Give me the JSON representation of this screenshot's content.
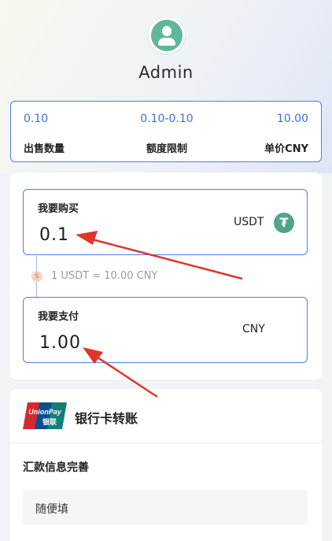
{
  "profile": {
    "name": "Admin"
  },
  "stats": {
    "quantity": {
      "value": "0.10",
      "label": "出售数量"
    },
    "limit": {
      "value": "0.10-0.10",
      "label": "额度限制"
    },
    "price": {
      "value": "10.00",
      "label": "单价CNY"
    }
  },
  "buy": {
    "title": "我要购买",
    "value": "0.1",
    "unit": "USDT",
    "icon": "tether-icon"
  },
  "rate": {
    "text": "1 USDT ≈ 10.00 CNY"
  },
  "pay": {
    "title": "我要支付",
    "value": "1.00",
    "unit": "CNY"
  },
  "payment_method": {
    "logo_text_top": "UnionPay",
    "logo_text_bottom": "银联",
    "label": "银行卡转账",
    "remittance_title": "汇款信息完善",
    "remittance_value": "随便填"
  },
  "colors": {
    "accent": "#4f7de0",
    "value_blue": "#3f6fd8",
    "tether": "#50a489",
    "arrow": "#e0352b"
  }
}
